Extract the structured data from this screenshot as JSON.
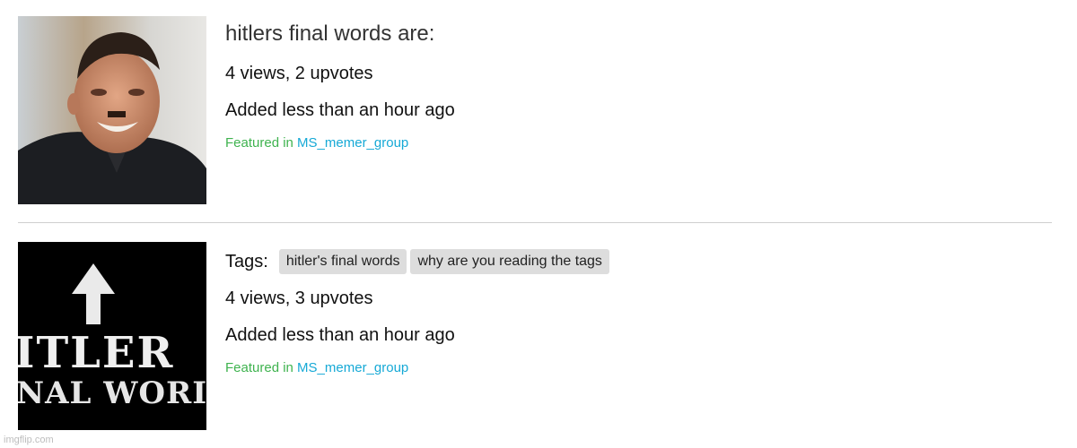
{
  "posts": [
    {
      "title": "hitlers final words are:",
      "stats": "4 views, 2 upvotes",
      "added": "Added less than an hour ago",
      "featured_prefix": "Featured in ",
      "featured_group": "MS_memer_group"
    },
    {
      "tags_label": "Tags:",
      "tags": [
        "hitler's final words",
        "why are you reading the tags"
      ],
      "stats": "4 views, 3 upvotes",
      "added": "Added less than an hour ago",
      "featured_prefix": "Featured in ",
      "featured_group": "MS_memer_group",
      "thumbnail_text": [
        "ITLER",
        "NAL WORI"
      ]
    }
  ],
  "watermark": "imgflip.com",
  "colors": {
    "featured_prefix": "#3fb34f",
    "group_link": "#16a9d6",
    "tag_bg": "#dddddd",
    "divider": "#cfcfcf"
  }
}
